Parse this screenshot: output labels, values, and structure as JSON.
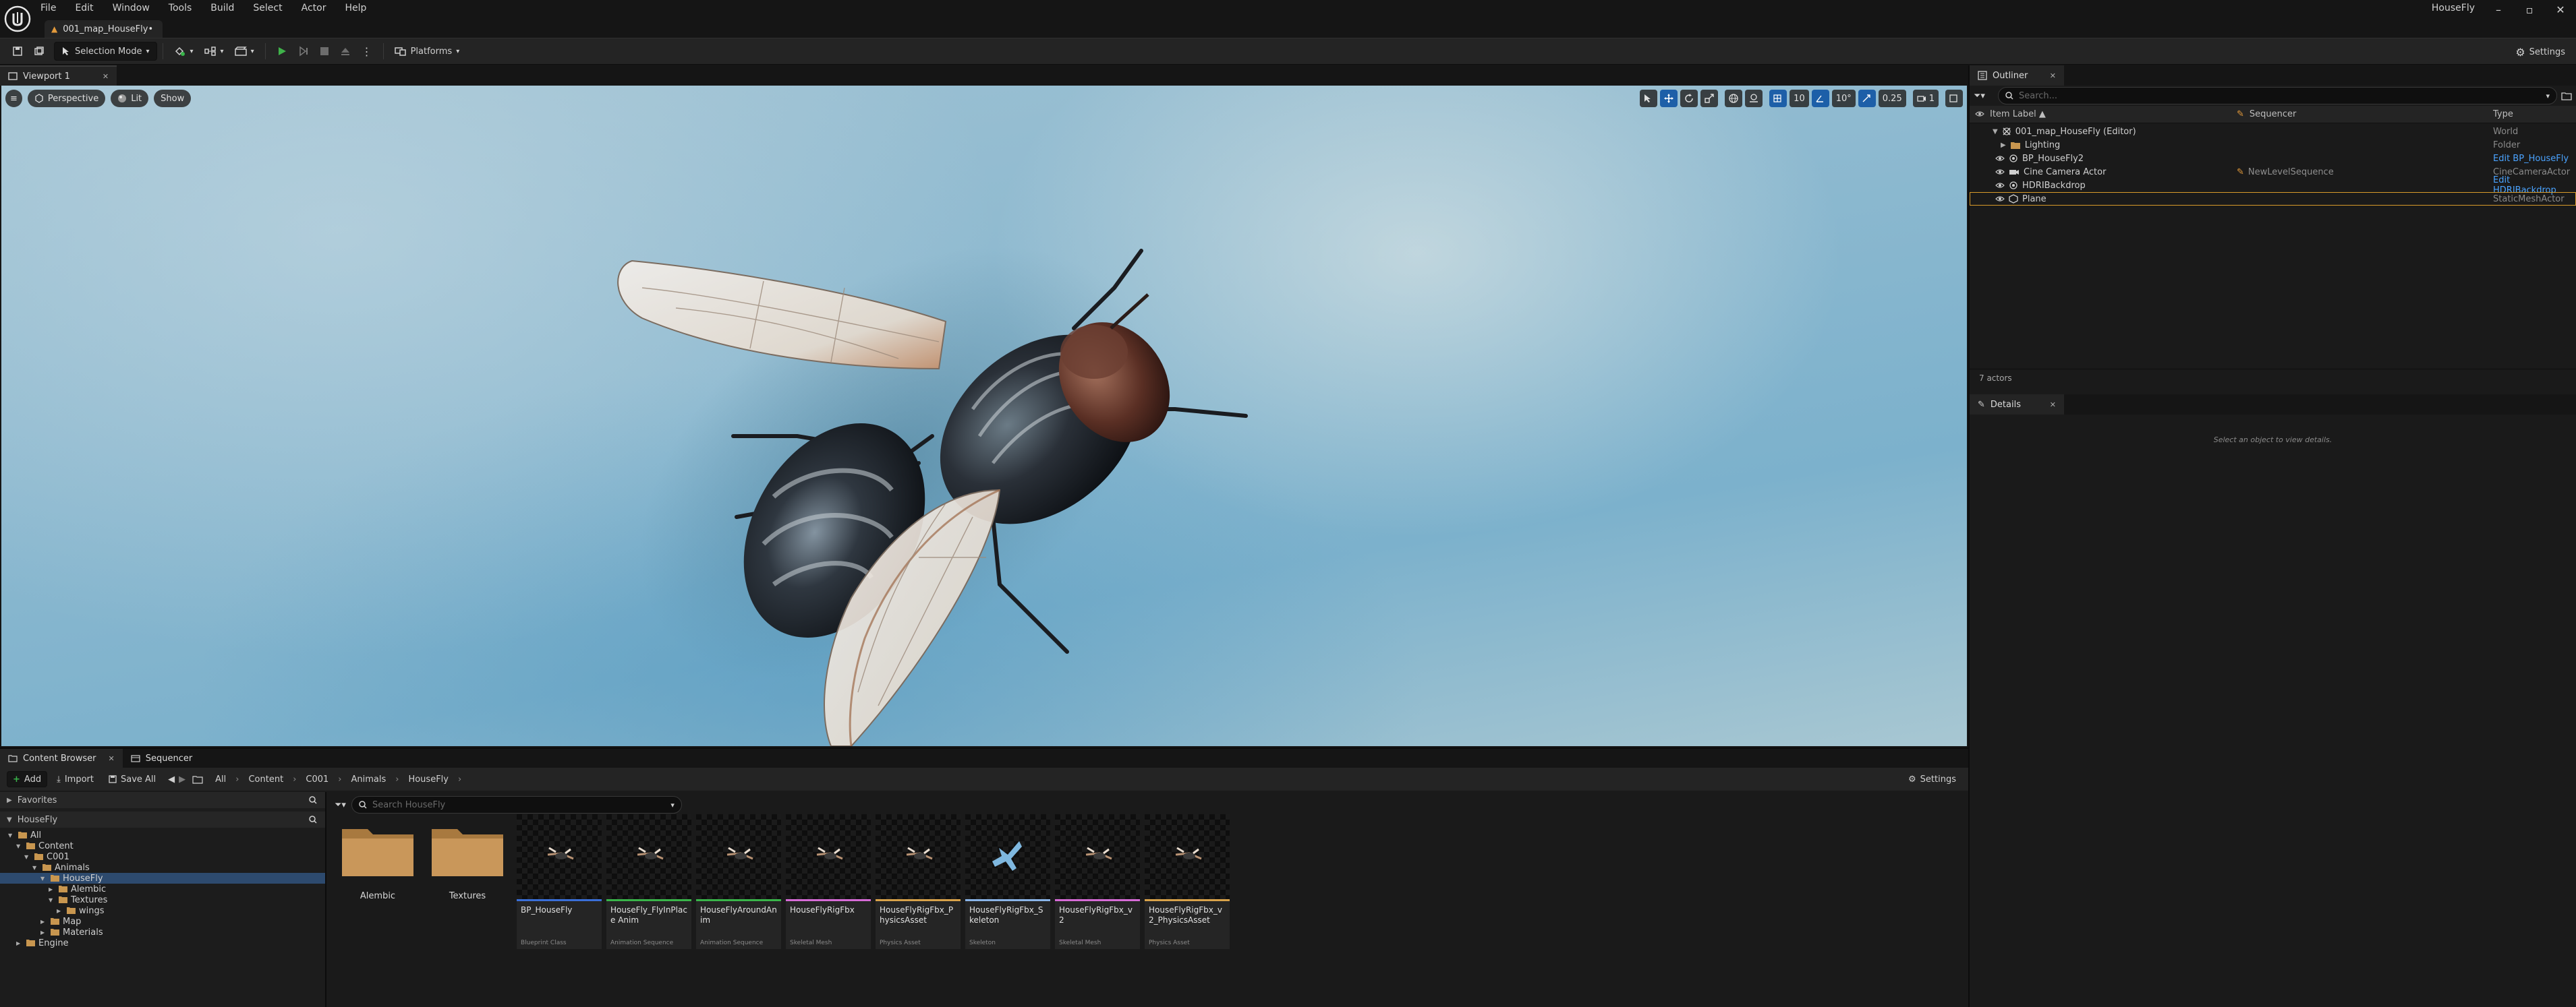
{
  "app": {
    "window_title": "HouseFly",
    "menu": [
      "File",
      "Edit",
      "Window",
      "Tools",
      "Build",
      "Select",
      "Actor",
      "Help"
    ],
    "level_tab": "001_map_HouseFly•"
  },
  "toolbar": {
    "selection_mode": "Selection Mode",
    "platforms": "Platforms",
    "settings": "Settings"
  },
  "viewport": {
    "tab": "Viewport 1",
    "perspective": "Perspective",
    "lit": "Lit",
    "show": "Show",
    "grid_snap": "10",
    "rotation_snap": "10°",
    "scale_snap": "0.25",
    "camera_speed": "1"
  },
  "outliner": {
    "tab": "Outliner",
    "search_placeholder": "Search...",
    "columns": {
      "label": "Item Label ▲",
      "sequencer": "Sequencer",
      "type": "Type"
    },
    "rows": [
      {
        "label": "001_map_HouseFly (Editor)",
        "seq": "",
        "type": "World",
        "link": false
      },
      {
        "label": "Lighting",
        "seq": "",
        "type": "Folder",
        "link": false
      },
      {
        "label": "BP_HouseFly2",
        "seq": "",
        "type": "Edit BP_HouseFly",
        "link": true
      },
      {
        "label": "Cine Camera Actor",
        "seq": "NewLevelSequence",
        "type": "CineCameraActor",
        "link": false
      },
      {
        "label": "HDRIBackdrop",
        "seq": "",
        "type": "Edit HDRIBackdrop",
        "link": true
      },
      {
        "label": "Plane",
        "seq": "",
        "type": "StaticMeshActor",
        "link": false
      }
    ],
    "actor_count": "7 actors"
  },
  "details": {
    "tab": "Details",
    "empty_msg": "Select an object to view details."
  },
  "content_browser": {
    "tab": "Content Browser",
    "tab2": "Sequencer",
    "add": "Add",
    "import": "Import",
    "save_all": "Save All",
    "settings": "Settings",
    "breadcrumb": [
      "All",
      "Content",
      "C001",
      "Animals",
      "HouseFly"
    ],
    "search_placeholder": "Search HouseFly",
    "favorites": "Favorites",
    "tree_root": "HouseFly",
    "tree": [
      {
        "label": "All",
        "depth": 0,
        "open": true
      },
      {
        "label": "Content",
        "depth": 1,
        "open": true
      },
      {
        "label": "C001",
        "depth": 2,
        "open": true
      },
      {
        "label": "Animals",
        "depth": 3,
        "open": true
      },
      {
        "label": "HouseFly",
        "depth": 4,
        "open": true,
        "selected": true
      },
      {
        "label": "Alembic",
        "depth": 5,
        "open": false
      },
      {
        "label": "Textures",
        "depth": 5,
        "open": true
      },
      {
        "label": "wings",
        "depth": 6,
        "open": false
      },
      {
        "label": "Map",
        "depth": 4,
        "open": false
      },
      {
        "label": "Materials",
        "depth": 4,
        "open": false
      },
      {
        "label": "Engine",
        "depth": 1,
        "open": false
      }
    ],
    "folders": [
      "Alembic",
      "Textures"
    ],
    "assets": [
      {
        "name": "BP_HouseFly",
        "kind": "Blueprint Class",
        "color": "#3a6fd8"
      },
      {
        "name": "HouseFly_FlyInPlace Anim",
        "kind": "Animation Sequence",
        "color": "#39b54a"
      },
      {
        "name": "HouseFlyAroundAnim",
        "kind": "Animation Sequence",
        "color": "#39b54a"
      },
      {
        "name": "HouseFlyRigFbx",
        "kind": "Skeletal Mesh",
        "color": "#d66bd6"
      },
      {
        "name": "HouseFlyRigFbx_PhysicsAsset",
        "kind": "Physics Asset",
        "color": "#d8a24a"
      },
      {
        "name": "HouseFlyRigFbx_Skeleton",
        "kind": "Skeleton",
        "color": "#8ab4e8"
      },
      {
        "name": "HouseFlyRigFbx_v2",
        "kind": "Skeletal Mesh",
        "color": "#d66bd6"
      },
      {
        "name": "HouseFlyRigFbx_v2_PhysicsAsset",
        "kind": "Physics Asset",
        "color": "#d8a24a"
      }
    ]
  }
}
